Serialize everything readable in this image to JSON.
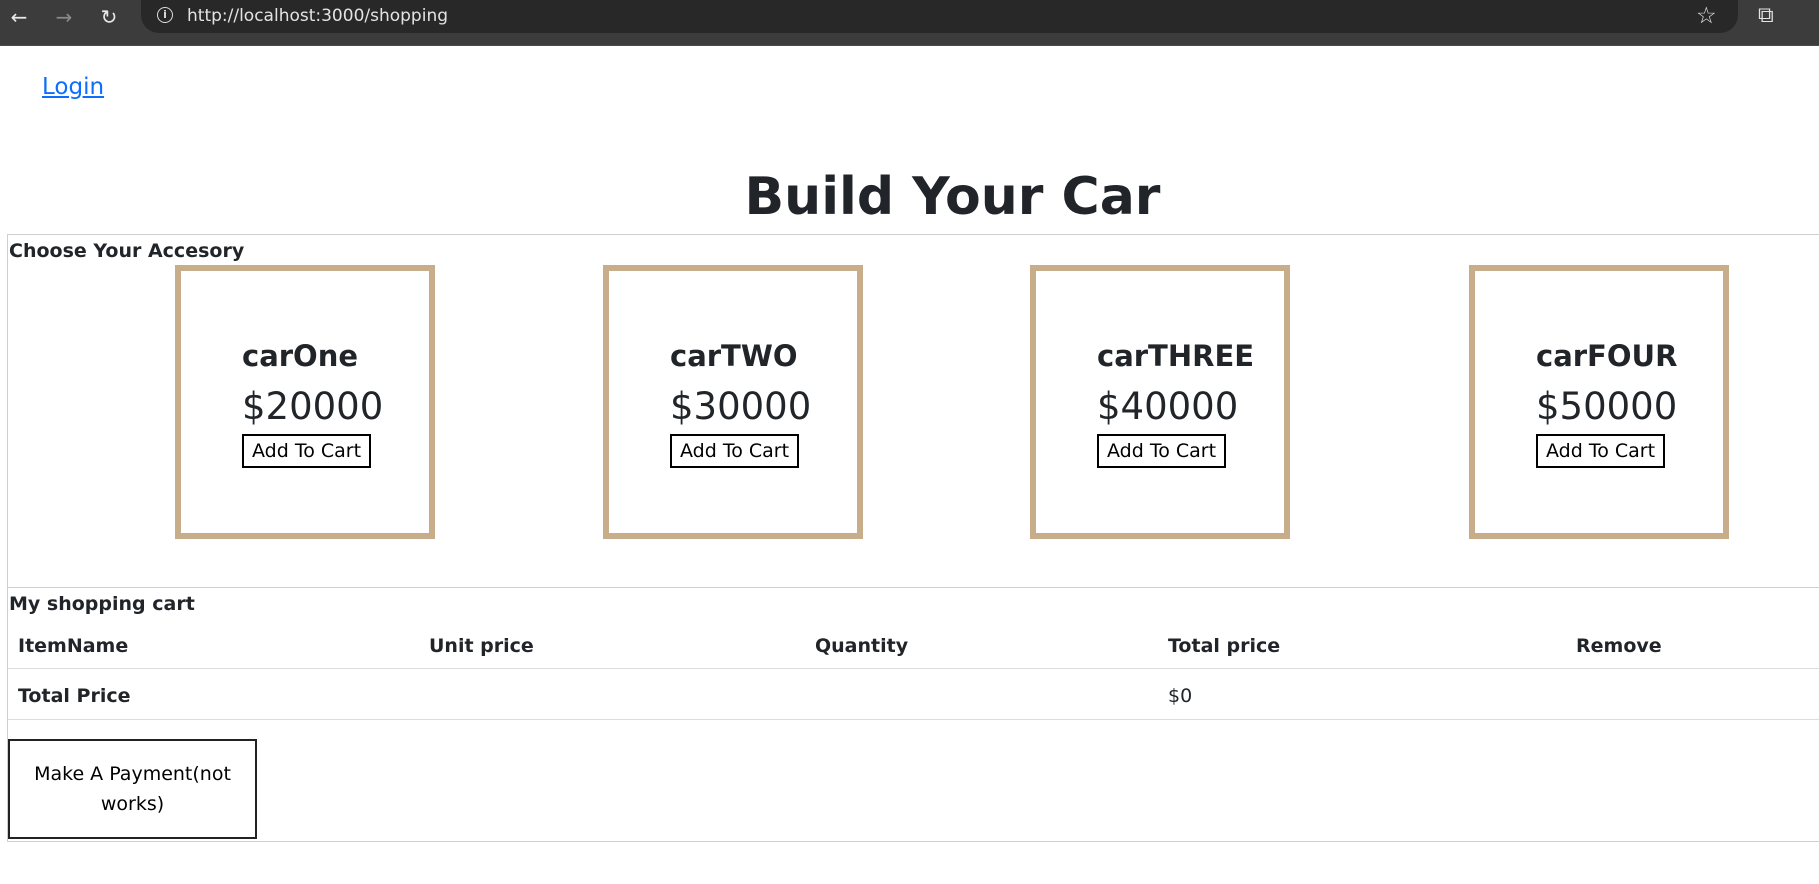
{
  "browser": {
    "url": "http://localhost:3000/shopping",
    "back_icon": "back-arrow-icon",
    "forward_icon": "forward-arrow-icon",
    "reload_icon": "reload-icon",
    "site_info_icon": "site-info-icon",
    "bookmark_icon": "star-icon",
    "extensions_icon": "extensions-icon"
  },
  "nav": {
    "login_label": "Login"
  },
  "page": {
    "title": "Build Your Car"
  },
  "accessories": {
    "heading": "Choose Your Accesory",
    "cards": [
      {
        "name": "carOne",
        "price": "$20000",
        "button": "Add To Cart"
      },
      {
        "name": "carTWO",
        "price": "$30000",
        "button": "Add To Cart"
      },
      {
        "name": "carTHREE",
        "price": "$40000",
        "button": "Add To Cart"
      },
      {
        "name": "carFOUR",
        "price": "$50000",
        "button": "Add To Cart"
      }
    ]
  },
  "cart": {
    "heading": "My shopping cart",
    "columns": [
      "ItemName",
      "Unit price",
      "Quantity",
      "Total price",
      "Remove"
    ],
    "total_label": "Total Price",
    "total_value": "$0",
    "pay_button": "Make A Payment(not works)"
  },
  "colors": {
    "card_border": "#c8ad8b",
    "link": "#0d6efd",
    "browser_bar": "#3c3c3c"
  }
}
